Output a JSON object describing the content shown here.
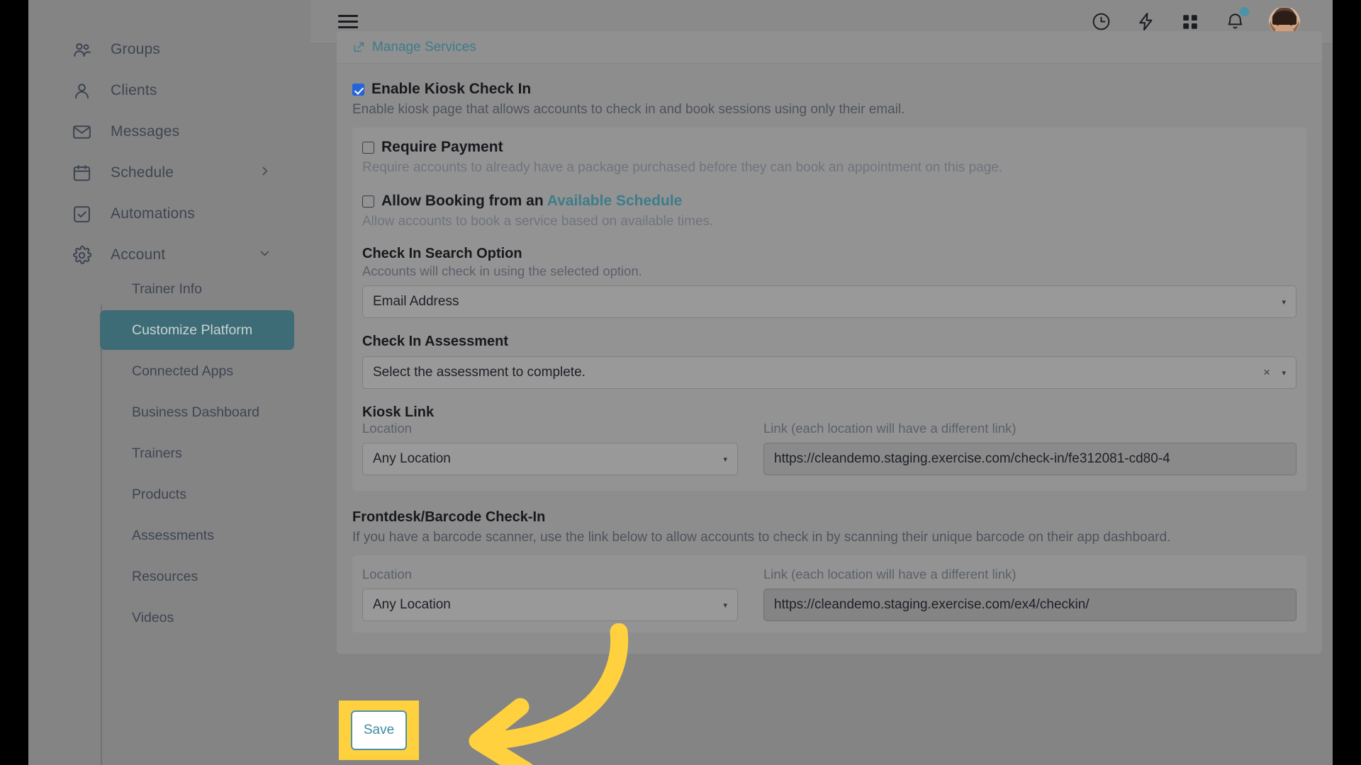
{
  "colors": {
    "accent_teal": "#3d6c76",
    "link_teal": "#3f7b8a",
    "highlight_yellow": "#ffd13f",
    "checkbox_blue": "#2563d9",
    "notification_dot": "#4a93a8"
  },
  "sidebar": {
    "items": [
      {
        "label": "Groups",
        "icon": "groups-icon",
        "has_chevron": false,
        "active": false
      },
      {
        "label": "Clients",
        "icon": "user-icon",
        "has_chevron": false,
        "active": false
      },
      {
        "label": "Messages",
        "icon": "envelope-icon",
        "has_chevron": false,
        "active": false
      },
      {
        "label": "Schedule",
        "icon": "calendar-icon",
        "has_chevron": true,
        "chevron": "right",
        "active": false
      },
      {
        "label": "Automations",
        "icon": "checkbox-square-icon",
        "has_chevron": false,
        "active": false
      },
      {
        "label": "Account",
        "icon": "gear-icon",
        "has_chevron": true,
        "chevron": "down",
        "active": false
      }
    ],
    "sub_items": [
      {
        "label": "Trainer Info",
        "active": false
      },
      {
        "label": "Customize Platform",
        "active": true
      },
      {
        "label": "Connected Apps",
        "active": false
      },
      {
        "label": "Business Dashboard",
        "active": false
      },
      {
        "label": "Trainers",
        "active": false
      },
      {
        "label": "Products",
        "active": false
      },
      {
        "label": "Assessments",
        "active": false
      },
      {
        "label": "Resources",
        "active": false
      },
      {
        "label": "Videos",
        "active": false
      }
    ]
  },
  "topbar": {
    "menu_icon": "hamburger-menu-icon",
    "actions": [
      {
        "icon": "clock-icon",
        "name": "recent-activity-button"
      },
      {
        "icon": "lightning-bolt-icon",
        "name": "quick-actions-button"
      },
      {
        "icon": "grid-apps-icon",
        "name": "apps-grid-button"
      },
      {
        "icon": "bell-icon",
        "name": "notifications-button",
        "has_badge": true
      }
    ],
    "avatar": "user-avatar"
  },
  "main": {
    "manage_services_link": "Manage Services",
    "manage_services_icon": "external-link-icon",
    "kiosk": {
      "title": "Enable Kiosk Check In",
      "checked": true,
      "description": "Enable kiosk page that allows accounts to check in and book sessions using only their email.",
      "require_payment": {
        "title": "Require Payment",
        "checked": false,
        "description": "Require accounts to already have a package purchased before they can book an appointment on this page."
      },
      "allow_booking": {
        "title_prefix": "Allow Booking from an ",
        "title_link": "Available Schedule",
        "checked": false,
        "description": "Allow accounts to book a service based on available times."
      },
      "search_option": {
        "label": "Check In Search Option",
        "sublabel": "Accounts will check in using the selected option.",
        "value": "Email Address"
      },
      "assessment": {
        "label": "Check In Assessment",
        "placeholder": "Select the assessment to complete.",
        "clear_icon": "clear-x-icon",
        "caret_icon": "chevron-down-icon"
      },
      "kiosk_link": {
        "label": "Kiosk Link",
        "location_label": "Location",
        "location_value": "Any Location",
        "link_label": "Link (each location will have a different link)",
        "link_value": "https://cleandemo.staging.exercise.com/check-in/fe312081-cd80-4"
      }
    },
    "frontdesk": {
      "title": "Frontdesk/Barcode Check-In",
      "description": "If you have a barcode scanner, use the link below to allow accounts to check in by scanning their unique barcode on their app dashboard.",
      "location_label": "Location",
      "location_value": "Any Location",
      "link_label": "Link (each location will have a different link)",
      "link_value": "https://cleandemo.staging.exercise.com/ex4/checkin/"
    },
    "save_label": "Save"
  },
  "annotation": {
    "arrow": "curved-arrow-pointing-left",
    "arrow_color": "#ffd13f",
    "highlight_target": "save-button"
  }
}
